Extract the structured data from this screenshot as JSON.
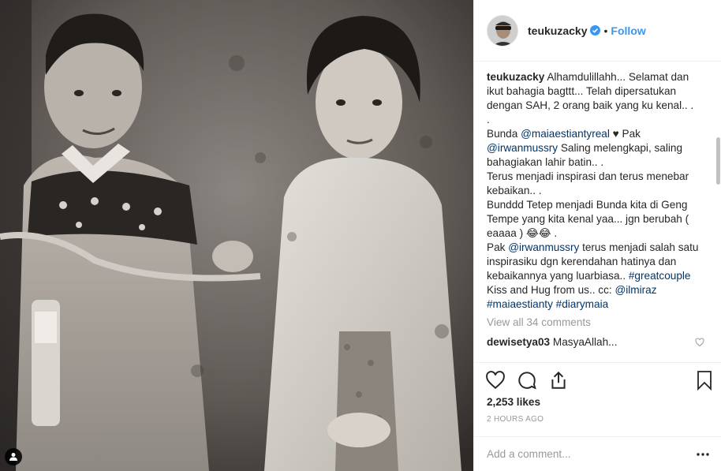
{
  "post": {
    "username": "teukuzacky",
    "follow_label": "Follow",
    "dot": "•",
    "verified_icon": "verified-badge-icon",
    "brand_color": "#3897f0"
  },
  "caption": {
    "username": "teukuzacky",
    "line1": "Alhamdulillahh... Selamat dan ikut bahagia bagttt... Telah dipersatukan dengan SAH, 2 orang baik yang ku kenal.. .",
    "line2": ".",
    "l3_pre": "Bunda ",
    "l3_mention": "@maiaestiantyreal",
    "l3_heart": " ♥ ",
    "l3_mid": "Pak ",
    "l3_mention2": "@irwanmussry",
    "l3_post": " Saling melengkapi, saling bahagiakan lahir batin.. .",
    "line4": "Terus menjadi inspirasi dan terus menebar kebaikan.. .",
    "line5": "Bunddd Tetep menjadi Bunda kita di Geng Tempe yang kita kenal yaa... jgn berubah ( eaaaa ) 😂😂 .",
    "l6_pre": "Pak ",
    "l6_mention": "@irwanmussry",
    "l6_mid": " terus menjadi salah satu inspirasiku dgn kerendahan hatinya dan kebaikannya yang luarbiasa.. ",
    "l6_tag": "#greatcouple",
    "l7_pre": "Kiss and Hug from us.. cc: ",
    "l7_mention": "@ilmiraz",
    "l8_tag1": "#maiaestianty",
    "l8_tag2": "#diarymaia"
  },
  "view_all": "View all 34 comments",
  "comment": {
    "username": "dewisetya03",
    "text": "MasyaAllah..."
  },
  "likes": "2,253 likes",
  "time_ago": "2 HOURS AGO",
  "add_comment": {
    "placeholder": "Add a comment..."
  },
  "icons": {
    "like": "heart-icon",
    "comment": "comment-icon",
    "share": "share-icon",
    "save": "bookmark-icon",
    "more": "more-options-icon",
    "tag": "person-tag-icon"
  }
}
